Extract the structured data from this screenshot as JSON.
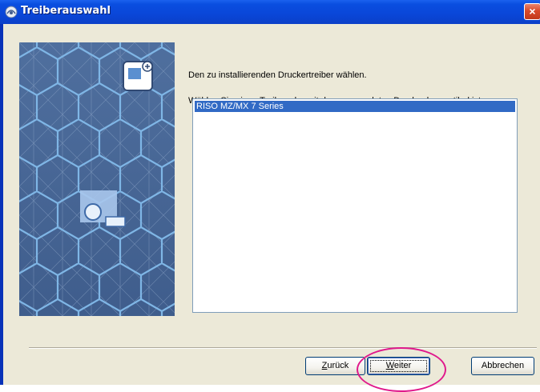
{
  "window": {
    "title": "Treiberauswahl",
    "close_label": "×",
    "title_icon": "installer-icon"
  },
  "content": {
    "instruction": "Den zu installierenden Druckertreiber wählen.",
    "hint": "Wählen Sie einen Treiber, der mit dem verwendeten Drucker kompatibel ist."
  },
  "driver_list": {
    "items": [
      "RISO MZ/MX 7 Series"
    ],
    "selected_index": 0
  },
  "buttons": {
    "back": {
      "mnemonic": "Z",
      "rest": "urück"
    },
    "next": {
      "mnemonic": "W",
      "rest": "eiter"
    },
    "cancel": "Abbrechen"
  },
  "colors": {
    "titlebar": "#0a4ee0",
    "selection": "#316ac5",
    "highlight_ellipse": "#e0198c",
    "panel": "#4a6a98"
  }
}
